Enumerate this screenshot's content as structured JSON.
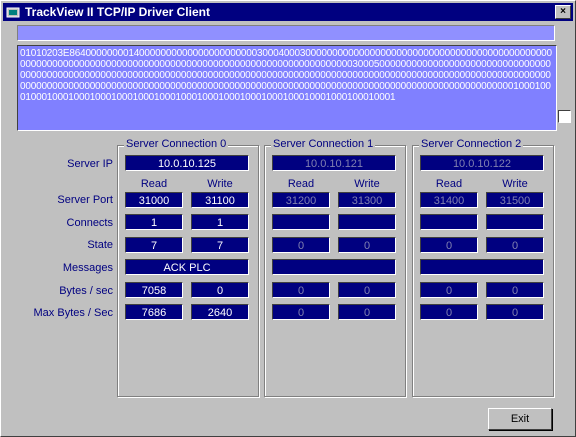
{
  "window": {
    "title": "TrackView II TCP/IP Driver Client",
    "close_label": "×"
  },
  "status_text": "",
  "hex_dump": "01010203E8640000000014000000000000000000000030004000300000000000000000000000000000000000000000000000000000000000000000000000000000000000000000000000000000000000030005000000000000000000000000000000000000000000000000000000000000000000000000000000000000000000000000000000000000000000000000000000000000000000000000000000000000000000000000000000000000000000000000000000000000000000000000000000010001000100010001000100010001000100010001000100010001000100010001000100010001",
  "row_labels": [
    "Server IP",
    "Server Port",
    "Connects",
    "State",
    "Messages",
    "Bytes / sec",
    "Max Bytes / Sec"
  ],
  "col_labels": {
    "read": "Read",
    "write": "Write"
  },
  "connections": [
    {
      "label": "Server Connection 0",
      "ip": "10.0.10.125",
      "port_read": "31000",
      "port_write": "31100",
      "connects_read": "1",
      "connects_write": "1",
      "state_read": "7",
      "state_write": "7",
      "messages": "ACK PLC",
      "bytes_read": "7058",
      "bytes_write": "0",
      "max_read": "7686",
      "max_write": "2640"
    },
    {
      "label": "Server Connection 1",
      "ip": "10.0.10.121",
      "port_read": "31200",
      "port_write": "31300",
      "connects_read": "",
      "connects_write": "",
      "state_read": "0",
      "state_write": "0",
      "messages": "",
      "bytes_read": "0",
      "bytes_write": "0",
      "max_read": "0",
      "max_write": "0"
    },
    {
      "label": "Server Connection 2",
      "ip": "10.0.10.122",
      "port_read": "31400",
      "port_write": "31500",
      "connects_read": "",
      "connects_write": "",
      "state_read": "0",
      "state_write": "0",
      "messages": "",
      "bytes_read": "0",
      "bytes_write": "0",
      "max_read": "0",
      "max_write": "0"
    }
  ],
  "exit_label": "Exit"
}
